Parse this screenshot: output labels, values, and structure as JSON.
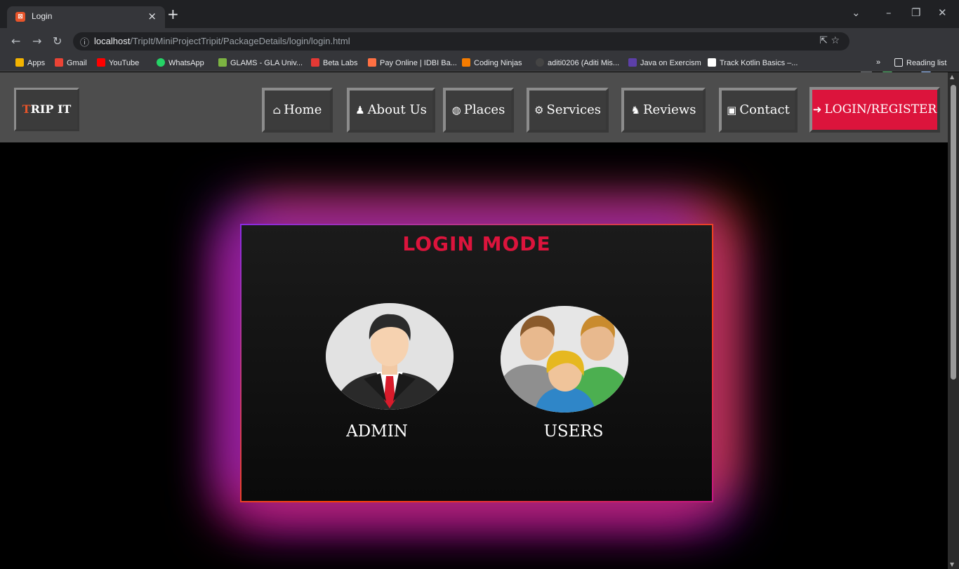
{
  "browser": {
    "tab_title": "Login",
    "url_host": "localhost",
    "url_path": "/TripIt/MiniProjectTripit/PackageDetails/login/login.html",
    "bookmarks": [
      {
        "label": "Apps",
        "color": "#f4b400"
      },
      {
        "label": "Gmail",
        "color": "#ea4335"
      },
      {
        "label": "YouTube",
        "color": "#ff0000"
      },
      {
        "label": "WhatsApp",
        "color": "#25d366"
      },
      {
        "label": "GLAMS - GLA Univ...",
        "color": "#7cb342"
      },
      {
        "label": "Beta Labs",
        "color": "#e53935"
      },
      {
        "label": "Pay Online | IDBI Ba...",
        "color": "#ff7043"
      },
      {
        "label": "Coding Ninjas",
        "color": "#f57c00"
      },
      {
        "label": "aditi0206 (Aditi Mis...",
        "color": "#444444"
      },
      {
        "label": "Java on Exercism",
        "color": "#5c3fa8"
      },
      {
        "label": "Track Kotlin Basics –...",
        "color": "#ffffff"
      }
    ],
    "reading_list": "Reading list",
    "overflow": "»"
  },
  "site": {
    "logo_first": "T",
    "logo_rest": "RIP IT",
    "nav": [
      {
        "label": "Home",
        "icon": "home-icon",
        "glyph": "⌂"
      },
      {
        "label": "About Us",
        "icon": "user-icon",
        "glyph": "♟"
      },
      {
        "label": "Places",
        "icon": "globe-icon",
        "glyph": "◍"
      },
      {
        "label": "Services",
        "icon": "gear-icon",
        "glyph": "⚙"
      },
      {
        "label": "Reviews",
        "icon": "user-plus-icon",
        "glyph": "♞"
      },
      {
        "label": "Contact",
        "icon": "contact-card-icon",
        "glyph": "▣"
      }
    ],
    "login_label": "LOGIN/REGISTER",
    "login_glyph": "➜",
    "accent": "#dc143c"
  },
  "login_card": {
    "title": "LOGIN MODE",
    "admin_label": "ADMIN",
    "users_label": "USERS"
  }
}
